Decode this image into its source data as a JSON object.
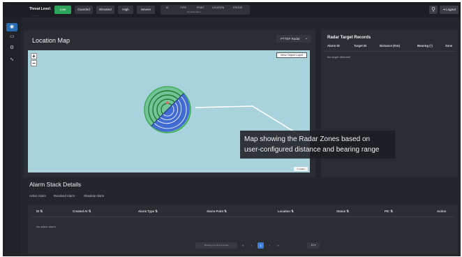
{
  "header": {
    "threat_level_label": "Threat Level:",
    "threat_levels": [
      {
        "label": "Low",
        "active": true
      },
      {
        "label": "Guarded",
        "active": false
      },
      {
        "label": "Elevated",
        "active": false
      },
      {
        "label": "High",
        "active": false
      },
      {
        "label": "Severe",
        "active": false
      }
    ],
    "status_columns": [
      "ID",
      "TYPE",
      "POINT",
      "LOCATION",
      "STATUS"
    ],
    "status_note": "No active alarm",
    "subtitle": "----------------",
    "user_icon": "person-icon",
    "logout_label": "Logout"
  },
  "sidebar": {
    "items": [
      {
        "icon": "eye-icon",
        "glyph": "◉",
        "active": true
      },
      {
        "icon": "folder-icon",
        "glyph": "▭",
        "active": false
      },
      {
        "icon": "gear-icon",
        "glyph": "⚙",
        "active": false
      },
      {
        "icon": "analytics-icon",
        "glyph": "∿",
        "active": false
      }
    ]
  },
  "location_map": {
    "title": "Location Map",
    "radar_select": "PTTEP Radar",
    "zoom_in": "+",
    "zoom_out": "−",
    "view_layer_button": "View Object Layer",
    "attribution": "© Leaflet",
    "colors": {
      "sea": "#a9d3dc",
      "range_zone": "#3fae56",
      "bearing_zone": "#3c63d8",
      "track": "#ffffff"
    },
    "caption_lines": [
      "Map showing the Radar Zones based on",
      "user-configured distance and bearing range"
    ]
  },
  "radar_records": {
    "title": "Radar Target Records",
    "columns": [
      "Alarm ID",
      "Target ID",
      "Distance (Km)",
      "Bearing (°)",
      "Zone"
    ],
    "empty_text": "No target detected"
  },
  "alarm_stack": {
    "title": "Alarm Stack Details",
    "tabs": [
      "Active Alarm",
      "Resolved Alarm",
      "Obsolete Alarm"
    ],
    "columns": [
      "ID ⇅",
      "Created At ⇅",
      "Alarm Type ⇅",
      "Alarm Point ⇅",
      "Location ⇅",
      "Status ⇅",
      "PIC ⇅",
      "Action"
    ],
    "empty_text": "No active alarm.",
    "pagination": {
      "info": "Showing 1 to 10 of 1 entries",
      "first": "«",
      "prev": "‹",
      "current": "1",
      "next": "›",
      "last": "»",
      "rows_per_page": "10 ▾"
    }
  }
}
